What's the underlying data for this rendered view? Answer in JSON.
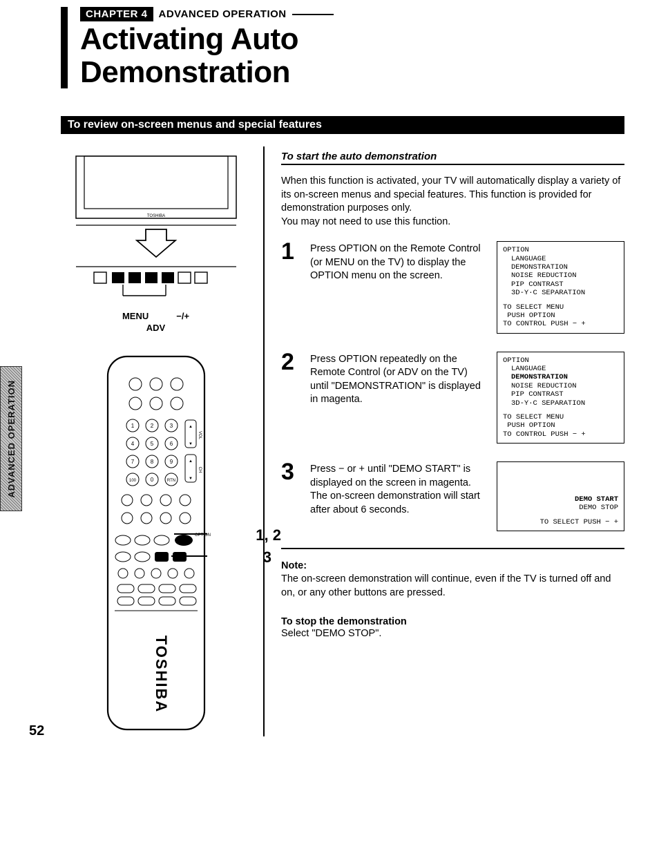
{
  "side_tab": "ADVANCED OPERATION",
  "chapter": {
    "box": "CHAPTER 4",
    "label": "ADVANCED OPERATION"
  },
  "title_line1": "Activating Auto",
  "title_line2": "Demonstration",
  "section_bar": "To review on-screen menus and special features",
  "subhead": "To start the auto demonstration",
  "intro": "When this function is activated, your TV will automatically display a variety of its on-screen menus and special features. This function is provided for demonstration purposes only.\nYou may not need to use this function.",
  "steps": [
    {
      "num": "1",
      "text": "Press OPTION on the Remote Control (or MENU on the TV) to display the OPTION menu on the screen.",
      "osd": {
        "head": "OPTION",
        "items": [
          "LANGUAGE",
          "DEMONSTRATION",
          "NOISE REDUCTION",
          "PIP CONTRAST",
          "3D-Y·C SEPARATION"
        ],
        "foot": [
          "TO SELECT MENU",
          " PUSH OPTION",
          "TO CONTROL PUSH − +"
        ]
      }
    },
    {
      "num": "2",
      "text": "Press OPTION repeatedly on the Remote Control (or ADV on the TV) until \"DEMONSTRATION\" is displayed in magenta.",
      "osd": {
        "head": "OPTION",
        "items": [
          "LANGUAGE",
          "DEMONSTRATION",
          "NOISE REDUCTION",
          "PIP CONTRAST",
          "3D-Y·C SEPARATION"
        ],
        "foot": [
          "TO SELECT MENU",
          " PUSH OPTION",
          "TO CONTROL PUSH − +"
        ]
      }
    },
    {
      "num": "3",
      "text": "Press − or + until \"DEMO START\" is displayed on the screen in magenta. The on-screen demonstration will start after about 6 seconds.",
      "osd_short": {
        "right_lines": [
          "DEMO START",
          "DEMO STOP"
        ],
        "foot": "TO SELECT PUSH − +"
      }
    }
  ],
  "note_head": "Note:",
  "note_body": "The on-screen demonstration will continue, even if the TV is turned off and on, or any other buttons are pressed.",
  "stop_head": "To stop the demonstration",
  "stop_body": "Select \"DEMO STOP\".",
  "tv_labels": {
    "menu": "MENU",
    "minus_plus": "−/+",
    "adv": "ADV"
  },
  "callouts": {
    "c12": "1, 2",
    "c3": "3"
  },
  "remote_brand": "TOSHIBA",
  "tv_brand": "TOSHIBA",
  "page_num": "52"
}
